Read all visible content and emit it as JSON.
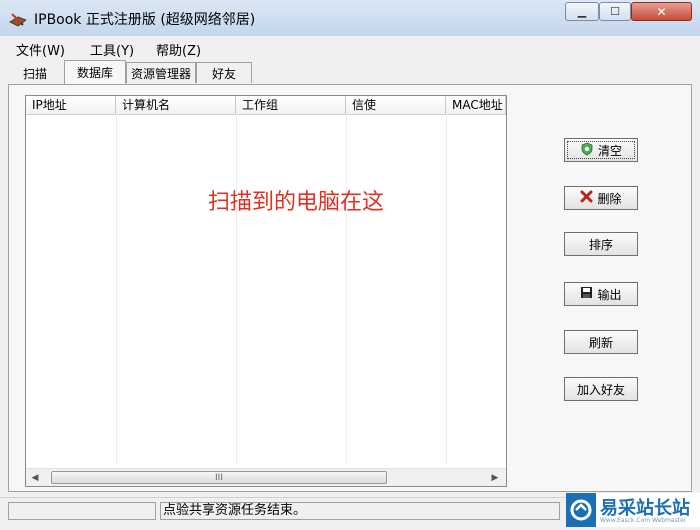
{
  "window": {
    "title": "IPBook 正式注册版 (超级网络邻居)",
    "controls": {
      "minimize": "▁",
      "maximize": "☐",
      "close": "✕"
    }
  },
  "menu": [
    "文件(W)",
    "工具(Y)",
    "帮助(Z)"
  ],
  "tabs": {
    "items": [
      "扫描",
      "数据库",
      "资源管理器",
      "好友"
    ],
    "selected": "数据库"
  },
  "list": {
    "columns": [
      "IP地址",
      "计算机名",
      "工作组",
      "信使",
      "MAC地址"
    ],
    "rows": [],
    "annotation": "扫描到的电脑在这",
    "scrollbar": {
      "left": "◀",
      "thumb": "III",
      "right": "▶"
    }
  },
  "buttons": {
    "clear": "清空",
    "delete": "删除",
    "sort": "排序",
    "export": "输出",
    "refresh": "刷新",
    "add_friend": "加入好友"
  },
  "status": {
    "pane1": "",
    "message": "点验共享资源任务结束。"
  },
  "watermark": {
    "text": "易采站长站",
    "sub": "Www.Easck.Com Webmaster"
  },
  "colors": {
    "annotation": "#e03020",
    "watermark": "#1a6fb5",
    "delete_icon": "#c0201a"
  }
}
